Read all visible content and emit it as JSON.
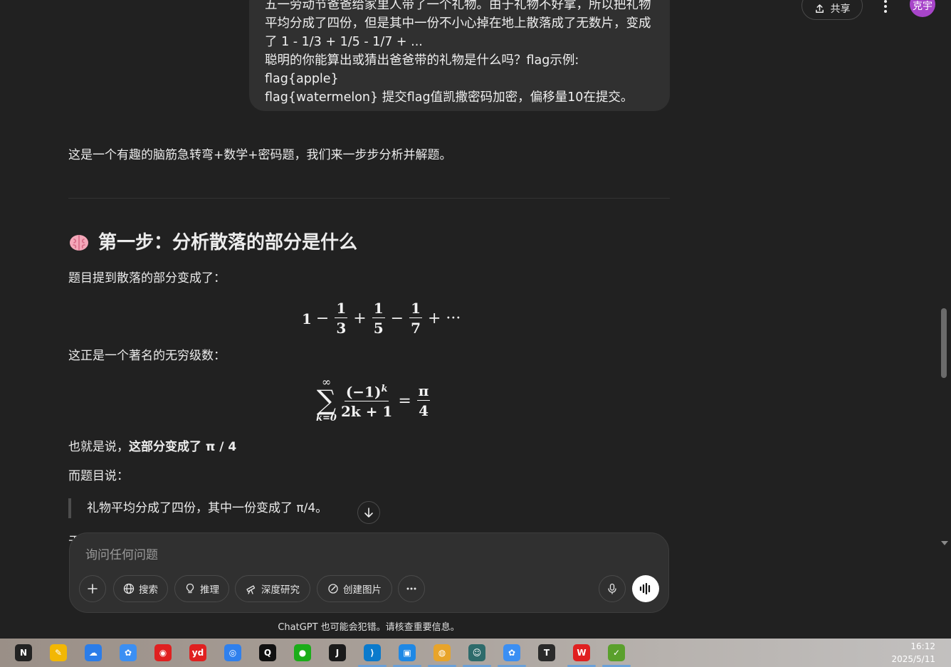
{
  "header": {
    "share_label": "共享",
    "avatar_text": "克宇"
  },
  "user_message": {
    "lines": [
      "五一劳动节爸爸给家里人带了一个礼物。由于礼物不好拿，所以把礼物",
      "平均分成了四份，但是其中一份不小心掉在地上散落成了无数片，变成",
      "了 1 - 1/3 + 1/5 - 1/7 + ...",
      "聪明的你能算出或猜出爸爸带的礼物是什么吗？flag示例: flag{apple}",
      "flag{watermelon} 提交flag值凯撒密码加密，偏移量10在提交。"
    ]
  },
  "answer": {
    "intro": "这是一个有趣的脑筋急转弯+数学+密码题，我们来一步步分析并解题。",
    "step1_title": "第一步：分析散落的部分是什么",
    "p1": "题目提到散落的部分变成了：",
    "series1": {
      "lead": "1",
      "op1": "−",
      "n1": "1",
      "d1": "3",
      "op2": "+",
      "n2": "1",
      "d2": "5",
      "op3": "−",
      "n3": "1",
      "d3": "7",
      "tail": "+ ···"
    },
    "p2": "这正是一个著名的无穷级数：",
    "series2": {
      "sum_top": "∞",
      "sum_sym": "∑",
      "sum_bottom": "k=0",
      "num": "(−1)",
      "num_exp": "k",
      "den": "2k + 1",
      "eq": "=",
      "rhs_num": "π",
      "rhs_den": "4"
    },
    "p3_prefix": "也就是说，",
    "p3_bold": "这部分变成了 π / 4",
    "p4": "而题目说：",
    "quote": "礼物平均分成了四份，其中一份变成了 π/4。",
    "cut_char": "于"
  },
  "composer": {
    "placeholder": "询问任何问题",
    "tools": [
      "搜索",
      "推理",
      "深度研究",
      "创建图片"
    ]
  },
  "disclaimer": "ChatGPT 也可能会犯错。请核查重要信息。",
  "taskbar": {
    "time": "16:12",
    "date": "2025/5/11",
    "apps": [
      {
        "name": "notion-icon",
        "label": "N",
        "color": "#222"
      },
      {
        "name": "pen-app-icon",
        "label": "✎",
        "color": "#f2b705"
      },
      {
        "name": "baidu-netdisk-icon",
        "label": "☁",
        "color": "#2b7de9"
      },
      {
        "name": "cloud-app-icon",
        "label": "✿",
        "color": "#3b8ff3"
      },
      {
        "name": "netease-music-icon",
        "label": "◉",
        "color": "#e02020"
      },
      {
        "name": "youdao-icon",
        "label": "yd",
        "color": "#e02020"
      },
      {
        "name": "search-app-icon",
        "label": "◎",
        "color": "#2f80ed"
      },
      {
        "name": "qq-icon",
        "label": "Q",
        "color": "#111"
      },
      {
        "name": "wechat-icon",
        "label": "●",
        "color": "#1aad19"
      },
      {
        "name": "jetbrains-icon",
        "label": "J",
        "color": "#1a1a1a"
      },
      {
        "name": "vscode-icon",
        "label": "⟩",
        "color": "#0a7acc"
      },
      {
        "name": "window-app-icon",
        "label": "▣",
        "color": "#1e88e5"
      },
      {
        "name": "chrome-icon",
        "label": "◍",
        "color": "#e8a42a"
      },
      {
        "name": "image-viewer-icon",
        "label": "☺",
        "color": "#2d6b6b"
      },
      {
        "name": "cloud-app-2-icon",
        "label": "✿",
        "color": "#3b8ff3"
      },
      {
        "name": "typora-icon",
        "label": "T",
        "color": "#2a2a2a"
      },
      {
        "name": "wps-icon",
        "label": "W",
        "color": "#e02020"
      },
      {
        "name": "notepad-icon",
        "label": "✓",
        "color": "#5aa02c"
      }
    ]
  }
}
